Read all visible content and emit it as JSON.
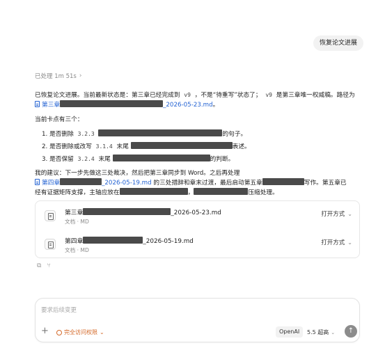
{
  "user_message": "恢复论文进展",
  "processed": {
    "label": "已处理 1m 51s",
    "chevron": "›"
  },
  "assistant": {
    "p1_a": "已恢复论文进展。当前最新状态是：第三章已经完成到",
    "p1_code1": "v9",
    "p1_b": "，不是“待重写”状态了；",
    "p1_code2": "v9",
    "p1_c": "是第三章唯一权威稿。路径为",
    "p1_link_start": "第三章",
    "p1_link_end": "_2026-05-23.md",
    "p1_end": "。",
    "p2": "当前卡点有三个：",
    "items": [
      {
        "num": "1.",
        "a": "是否删除",
        "code": "3.2.3",
        "b": "的句子。"
      },
      {
        "num": "2.",
        "a": "是否删除或改写",
        "code": "3.1.4",
        "c": "末尾",
        "b": "表述。"
      },
      {
        "num": "3.",
        "a": "是否保留",
        "code": "3.2.4",
        "c": "末尾",
        "b": "的判断。"
      }
    ],
    "p3_a": "我的建议：下一步先做这三处裁决，然后把第三章同步到 Word。之后再处理",
    "p3_link_start": "第四章",
    "p3_link_end": "_2026-05-19.md",
    "p3_b": "的三处措辞和章末过渡，最后启动第五章",
    "p3_c": "写作。第五章已",
    "p3_d": "经有证据矩阵支撑，主轴应放在",
    "p3_e": "，",
    "p3_f": "压缩处理。"
  },
  "files": [
    {
      "name_start": "第三章",
      "name_end": "_2026-05-23.md",
      "meta": "文档 · MD",
      "action": "打开方式",
      "icon": "document-icon"
    },
    {
      "name_start": "第四章",
      "name_end": "_2026-05-19.md",
      "meta": "文档 · MD",
      "action": "打开方式",
      "icon": "document-icon"
    }
  ],
  "composer": {
    "placeholder": "要求后续变更",
    "plus": "+",
    "permission": "完全访问权限",
    "provider": "OpenAI",
    "model": "5.5 超高",
    "send": "↑"
  },
  "colors": {
    "link": "#2463d3",
    "permission": "#d46a2a",
    "redaction": "#4a4a4a"
  }
}
